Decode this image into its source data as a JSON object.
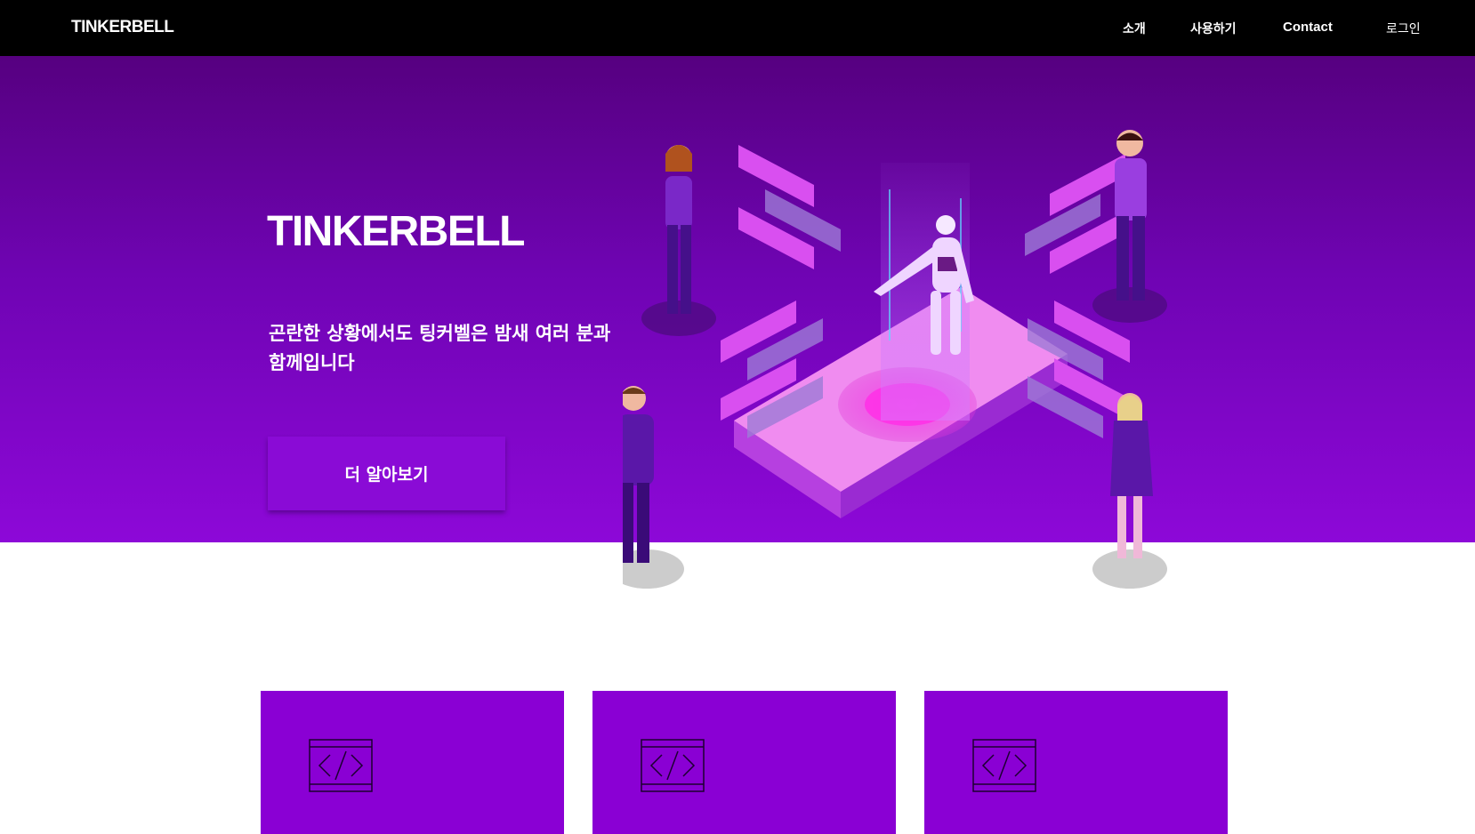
{
  "nav": {
    "logo": "TINKERBELL",
    "links": [
      {
        "label": "소개"
      },
      {
        "label": "사용하기"
      },
      {
        "label": "Contact"
      },
      {
        "label": "로그인"
      }
    ]
  },
  "hero": {
    "title": "TINKERBELL",
    "description": "곤란한 상황에서도 팅커벨은 밤새 여러 분과 함께입니다",
    "button_label": "더 알아보기"
  },
  "cards": [
    {
      "icon": "code-icon"
    },
    {
      "icon": "code-icon"
    },
    {
      "icon": "code-icon"
    }
  ],
  "colors": {
    "nav_bg": "#000000",
    "hero_top": "#560080",
    "hero_bottom": "#8d08d8",
    "card_bg": "#8a00d4",
    "accent": "#8a0bd6"
  }
}
